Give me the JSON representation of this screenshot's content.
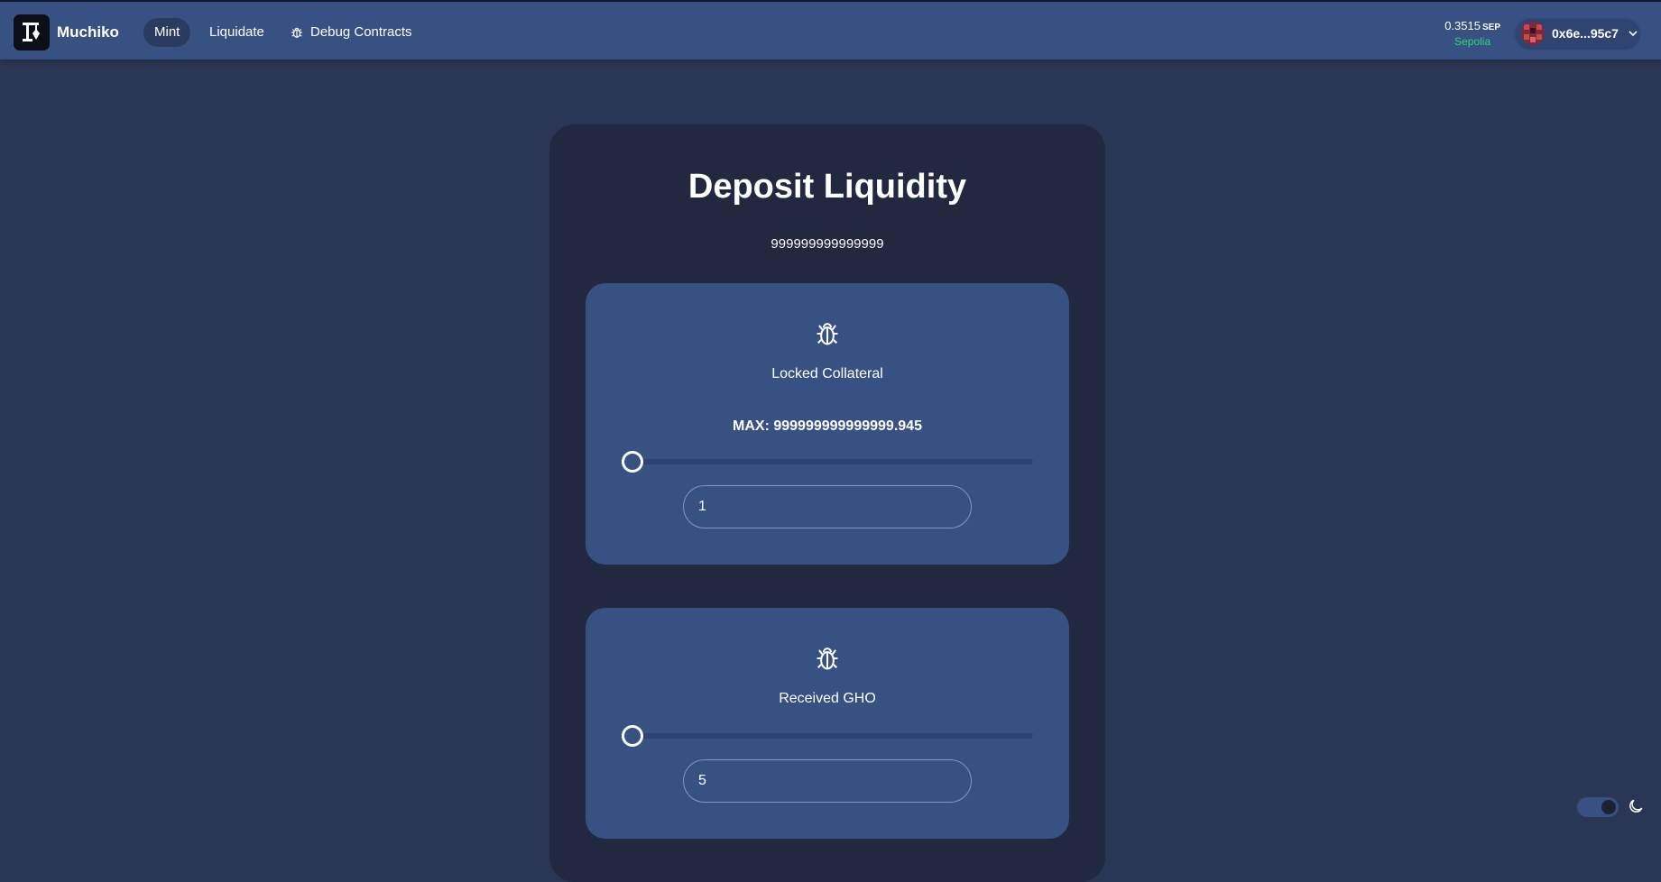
{
  "header": {
    "brand": "Muchiko",
    "nav": [
      {
        "label": "Mint",
        "active": true
      },
      {
        "label": "Liquidate",
        "active": false
      },
      {
        "label": "Debug Contracts",
        "icon": "bug-icon",
        "active": false
      }
    ],
    "balance": {
      "amount": "0.3515",
      "unit": "SEP",
      "network": "Sepolia"
    },
    "account": {
      "address": "0x6e...95c7",
      "icon": "chevron-down-icon"
    }
  },
  "card": {
    "title": "Deposit Liquidity",
    "subtitle": "999999999999999",
    "collateral": {
      "icon": "bug-icon",
      "label": "Locked Collateral",
      "max_label": "MAX: 999999999999999.945",
      "slider_fraction": 0,
      "input_value": "1"
    },
    "gho": {
      "icon": "bug-icon",
      "label": "Received GHO",
      "slider_fraction": 0,
      "input_value": "5"
    }
  },
  "theme": {
    "mode": "dark",
    "icon": "moon-icon"
  },
  "colors": {
    "background": "#2a3655",
    "header": "#385183",
    "card": "#212840",
    "panel": "#385183",
    "network_green": "#34d27a"
  }
}
